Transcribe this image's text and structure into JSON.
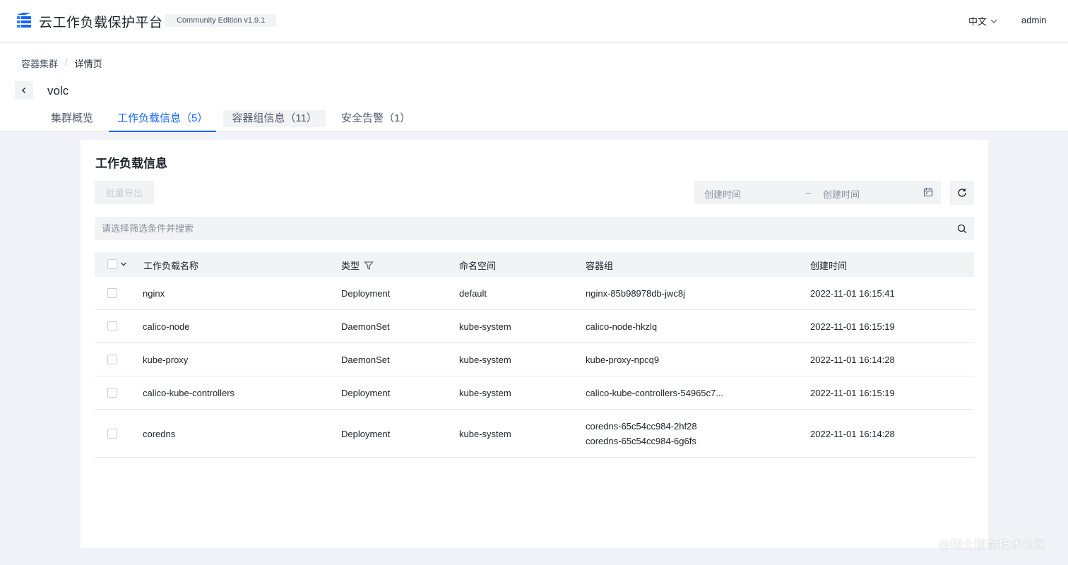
{
  "app": {
    "title": "云工作负载保护平台",
    "edition": "Community Edition v1.9.1",
    "language": "中文",
    "user": "admin",
    "accent_color": "#1664ff"
  },
  "breadcrumb": {
    "parent": "容器集群",
    "separator": "/",
    "current": "详情页"
  },
  "cluster": {
    "name": "volc"
  },
  "tabs": [
    {
      "label": "集群概览",
      "active": false
    },
    {
      "label": "工作负载信息（5）",
      "active": true
    },
    {
      "label": "容器组信息（11）",
      "active": false
    },
    {
      "label": "安全告警（1）",
      "active": false
    }
  ],
  "card": {
    "title": "工作负载信息",
    "export_label": "批量导出",
    "date_start_placeholder": "创建时间",
    "date_separator": "–",
    "date_end_placeholder": "创建时间",
    "search_placeholder": "请选择筛选条件并搜索"
  },
  "table": {
    "columns": {
      "name": "工作负载名称",
      "type": "类型",
      "namespace": "命名空间",
      "pods": "容器组",
      "created": "创建时间"
    },
    "rows": [
      {
        "name": "nginx",
        "type": "Deployment",
        "namespace": "default",
        "pods": [
          "nginx-85b98978db-jwc8j"
        ],
        "created": "2022-11-01 16:15:41"
      },
      {
        "name": "calico-node",
        "type": "DaemonSet",
        "namespace": "kube-system",
        "pods": [
          "calico-node-hkzlq"
        ],
        "created": "2022-11-01 16:15:19"
      },
      {
        "name": "kube-proxy",
        "type": "DaemonSet",
        "namespace": "kube-system",
        "pods": [
          "kube-proxy-npcq9"
        ],
        "created": "2022-11-01 16:14:28"
      },
      {
        "name": "calico-kube-controllers",
        "type": "Deployment",
        "namespace": "kube-system",
        "pods": [
          "calico-kube-controllers-54965c7..."
        ],
        "created": "2022-11-01 16:15:19"
      },
      {
        "name": "coredns",
        "type": "Deployment",
        "namespace": "kube-system",
        "pods": [
          "coredns-65c54cc984-2hf28",
          "coredns-65c54cc984-6g6fs"
        ],
        "created": "2022-11-01 16:14:28"
      }
    ]
  },
  "watermark": "@稀土掘金技术社区"
}
